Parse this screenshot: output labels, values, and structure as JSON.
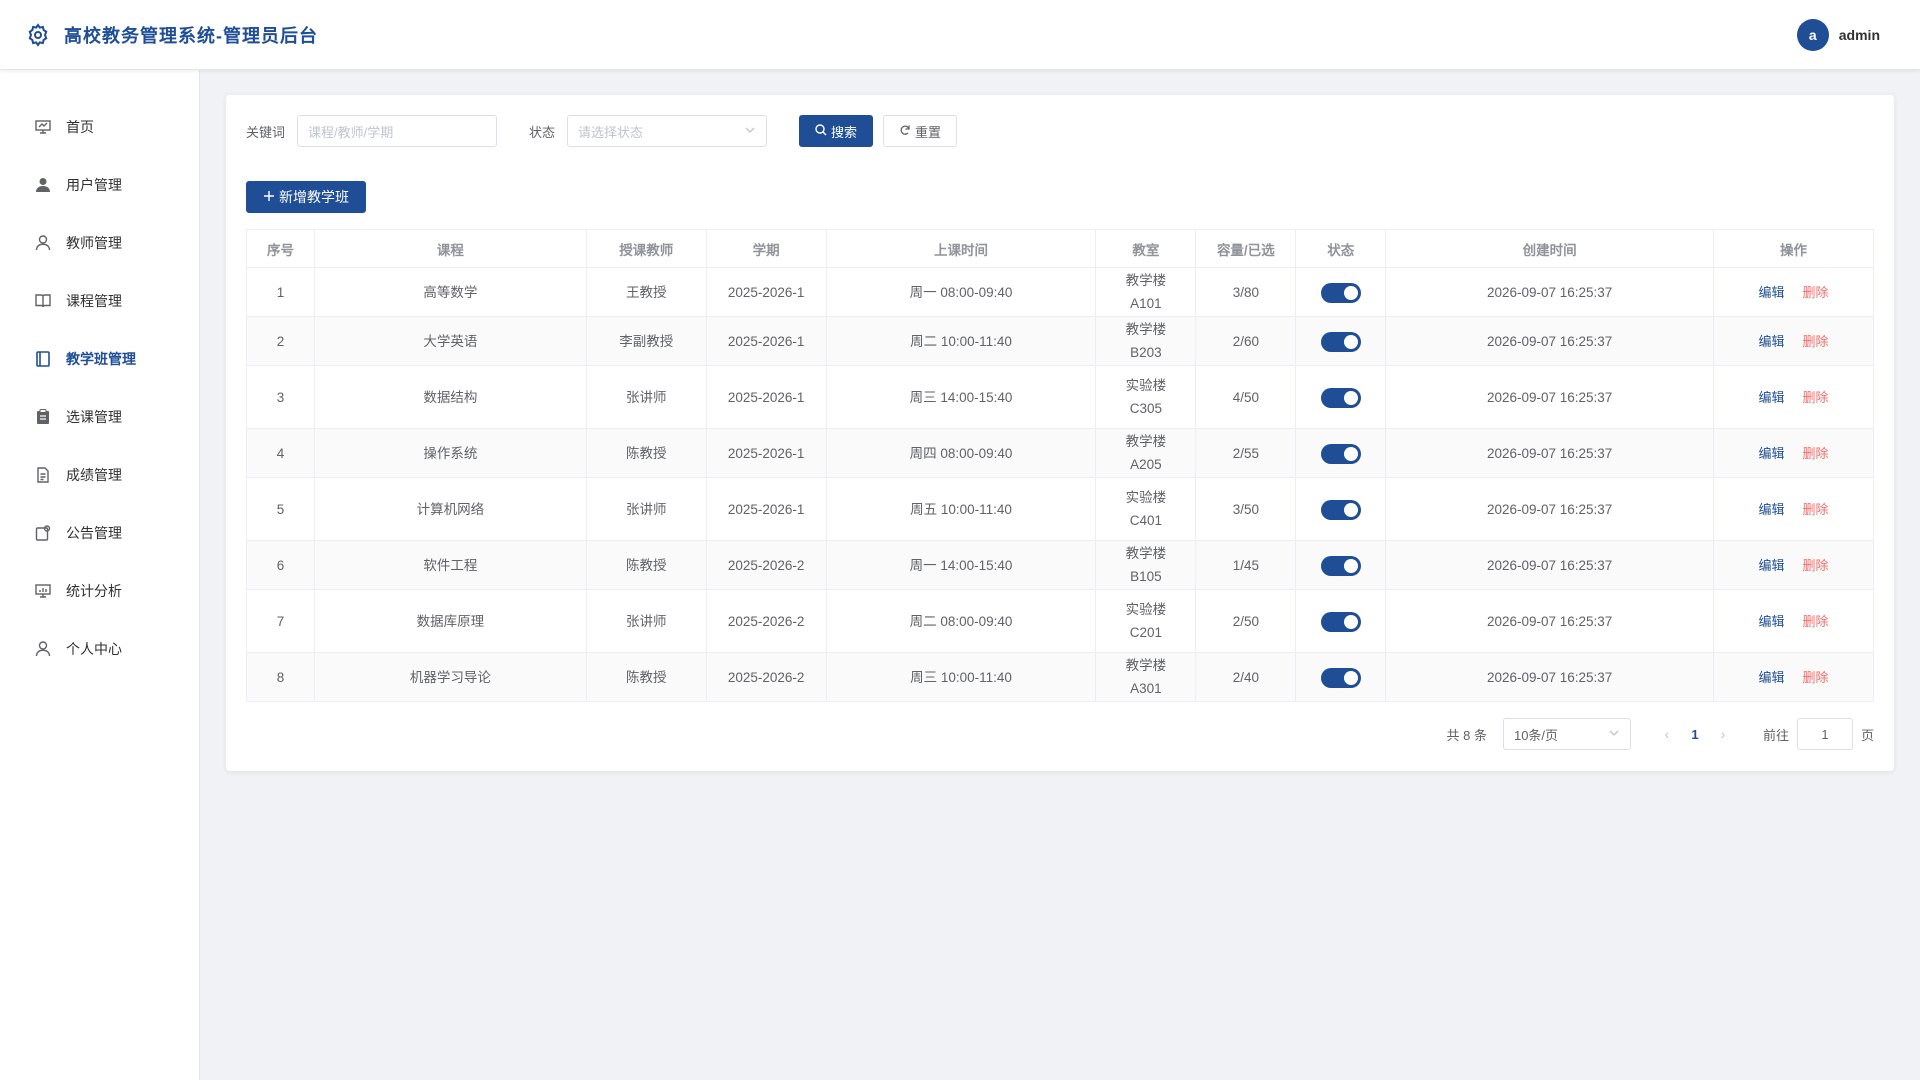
{
  "header": {
    "title": "高校教务管理系统-管理员后台",
    "avatar_letter": "a",
    "username": "admin"
  },
  "sidebar": {
    "items": [
      {
        "label": "首页",
        "icon": "dashboard-icon"
      },
      {
        "label": "用户管理",
        "icon": "user-icon"
      },
      {
        "label": "教师管理",
        "icon": "teacher-icon"
      },
      {
        "label": "课程管理",
        "icon": "book-icon"
      },
      {
        "label": "教学班管理",
        "icon": "class-icon"
      },
      {
        "label": "选课管理",
        "icon": "clipboard-icon"
      },
      {
        "label": "成绩管理",
        "icon": "document-icon"
      },
      {
        "label": "公告管理",
        "icon": "notice-icon"
      },
      {
        "label": "统计分析",
        "icon": "chart-icon"
      },
      {
        "label": "个人中心",
        "icon": "person-icon"
      }
    ],
    "active_index": 4
  },
  "filters": {
    "keyword_label": "关键词",
    "keyword_placeholder": "课程/教师/学期",
    "status_label": "状态",
    "status_placeholder": "请选择状态",
    "search_label": "搜索",
    "reset_label": "重置"
  },
  "add_button_label": "新增教学班",
  "table": {
    "columns": [
      "序号",
      "课程",
      "授课教师",
      "学期",
      "上课时间",
      "教室",
      "容量/已选",
      "状态",
      "创建时间",
      "操作"
    ],
    "rows": [
      {
        "no": "1",
        "course": "高等数学",
        "teacher": "王教授",
        "term": "2025-2026-1",
        "time": "周一 08:00-09:40",
        "room": "教学楼A101",
        "capacity": "3/80",
        "enabled": true,
        "created": "2026-09-07 16:25:37"
      },
      {
        "no": "2",
        "course": "大学英语",
        "teacher": "李副教授",
        "term": "2025-2026-1",
        "time": "周二 10:00-11:40",
        "room": "教学楼B203",
        "capacity": "2/60",
        "enabled": true,
        "created": "2026-09-07 16:25:37"
      },
      {
        "no": "3",
        "course": "数据结构",
        "teacher": "张讲师",
        "term": "2025-2026-1",
        "time": "周三 14:00-15:40",
        "room": "实验楼C305",
        "capacity": "4/50",
        "enabled": true,
        "created": "2026-09-07 16:25:37"
      },
      {
        "no": "4",
        "course": "操作系统",
        "teacher": "陈教授",
        "term": "2025-2026-1",
        "time": "周四 08:00-09:40",
        "room": "教学楼A205",
        "capacity": "2/55",
        "enabled": true,
        "created": "2026-09-07 16:25:37"
      },
      {
        "no": "5",
        "course": "计算机网络",
        "teacher": "张讲师",
        "term": "2025-2026-1",
        "time": "周五 10:00-11:40",
        "room": "实验楼C401",
        "capacity": "3/50",
        "enabled": true,
        "created": "2026-09-07 16:25:37"
      },
      {
        "no": "6",
        "course": "软件工程",
        "teacher": "陈教授",
        "term": "2025-2026-2",
        "time": "周一 14:00-15:40",
        "room": "教学楼B105",
        "capacity": "1/45",
        "enabled": true,
        "created": "2026-09-07 16:25:37"
      },
      {
        "no": "7",
        "course": "数据库原理",
        "teacher": "张讲师",
        "term": "2025-2026-2",
        "time": "周二 08:00-09:40",
        "room": "实验楼C201",
        "capacity": "2/50",
        "enabled": true,
        "created": "2026-09-07 16:25:37"
      },
      {
        "no": "8",
        "course": "机器学习导论",
        "teacher": "陈教授",
        "term": "2025-2026-2",
        "time": "周三 10:00-11:40",
        "room": "教学楼A301",
        "capacity": "2/40",
        "enabled": true,
        "created": "2026-09-07 16:25:37"
      }
    ],
    "edit_label": "编辑",
    "delete_label": "删除"
  },
  "pagination": {
    "total_text": "共 8 条",
    "page_size": "10条/页",
    "current_page": "1",
    "goto_label": "前往",
    "goto_value": "1",
    "page_suffix": "页"
  },
  "colors": {
    "primary": "#1f4e96",
    "danger": "#f56c6c"
  }
}
